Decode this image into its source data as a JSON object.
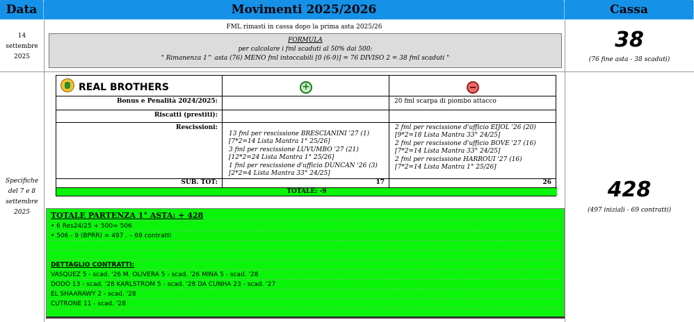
{
  "header": {
    "data": "Data",
    "movimenti": "Movimenti 2025/2026",
    "cassa": "Cassa"
  },
  "row1": {
    "date": [
      "14",
      "settembre",
      "2025"
    ],
    "note": "FML rimasti in cassa dopo la prima asta 2025/26",
    "formula_title": "FORMULA",
    "formula_line1": "per calcolare i fml scaduti al 50% dai 500:",
    "formula_line2": "\" Rimanenza 1^ asta (76) MENO fml intoccabili [0 (6-9)] = 76 DIVISO 2 = 38 fml scaduti \"",
    "cassa_value": "38",
    "cassa_note": "(76 fine asta - 38 scaduti)"
  },
  "row2": {
    "date": [
      "Specifiche",
      "del 7 e 8",
      "settembre",
      "2025"
    ],
    "team_name": "REAL BROTHERS",
    "labels": {
      "bonus": "Bonus e Penalità 2024/2025:",
      "riscatti": "Riscatti (prestiti):",
      "rescissioni": "Rescissioni:",
      "subtot": "SUB. TOT:"
    },
    "minus_bonus": "20 fml scarpa di piombo attacco",
    "plus_rescissioni": [
      "13 fml per rescissione BRESCIANINI '27 (1)",
      "[7*2=14 Lista Mantra 1° 25/26]",
      "3 fml per rescissione LUVUMBO '27 (21)",
      "[12*2=24 Lista Mantra 1° 25/26]",
      "1 fml per rescissione d'ufficio DUNCAN '26 (3)",
      "[2*2=4 Lista Mantra 33° 24/25]"
    ],
    "minus_rescissioni": [
      "2 fml per rescissione d'ufficio EIJOL '26 (20)",
      "[9*2=18 Lista Mantra 33° 24/25]",
      "2 fml per rescissione d'ufficio BOVE '27 (16)",
      "[7*2=14 Lista Mantra 33° 24/25]",
      "2 fml per rescissione HARROUI '27 (16)",
      "[7*2=14 Lista Mantra 1° 25/26]"
    ],
    "plus_subtot": "17",
    "minus_subtot": "26",
    "totale": "TOTALE: -9",
    "cassa_value": "428",
    "cassa_note": "(497 iniziali - 69 contratti)"
  },
  "green": {
    "title": "TOTALE PARTENZA 1° ASTA: + 428",
    "lines": [
      "• 6 Res24/25 + 500= 506",
      "• 506 - 9 (BPRR) = 497 . – 69 contratti"
    ],
    "detail_title": "DETTAGLIO CONTRATTI:",
    "contracts": [
      "VASQUEZ 5 - scad. '26 M. OLIVERA 5 - scad. '26 MINA 5 - scad. '28",
      "DODÒ 13 - scad. '28 KARLSTROM 5 - scad. '28 DA CUNHA 23 - scad. '27",
      "EL SHAARAWY 2 - scad. '28",
      "CUTRONE 11 - scad. '28"
    ]
  },
  "colors": {
    "header_blue": "#1591e8",
    "green": "#0af50a",
    "formula_gray": "#dcdcdc"
  }
}
